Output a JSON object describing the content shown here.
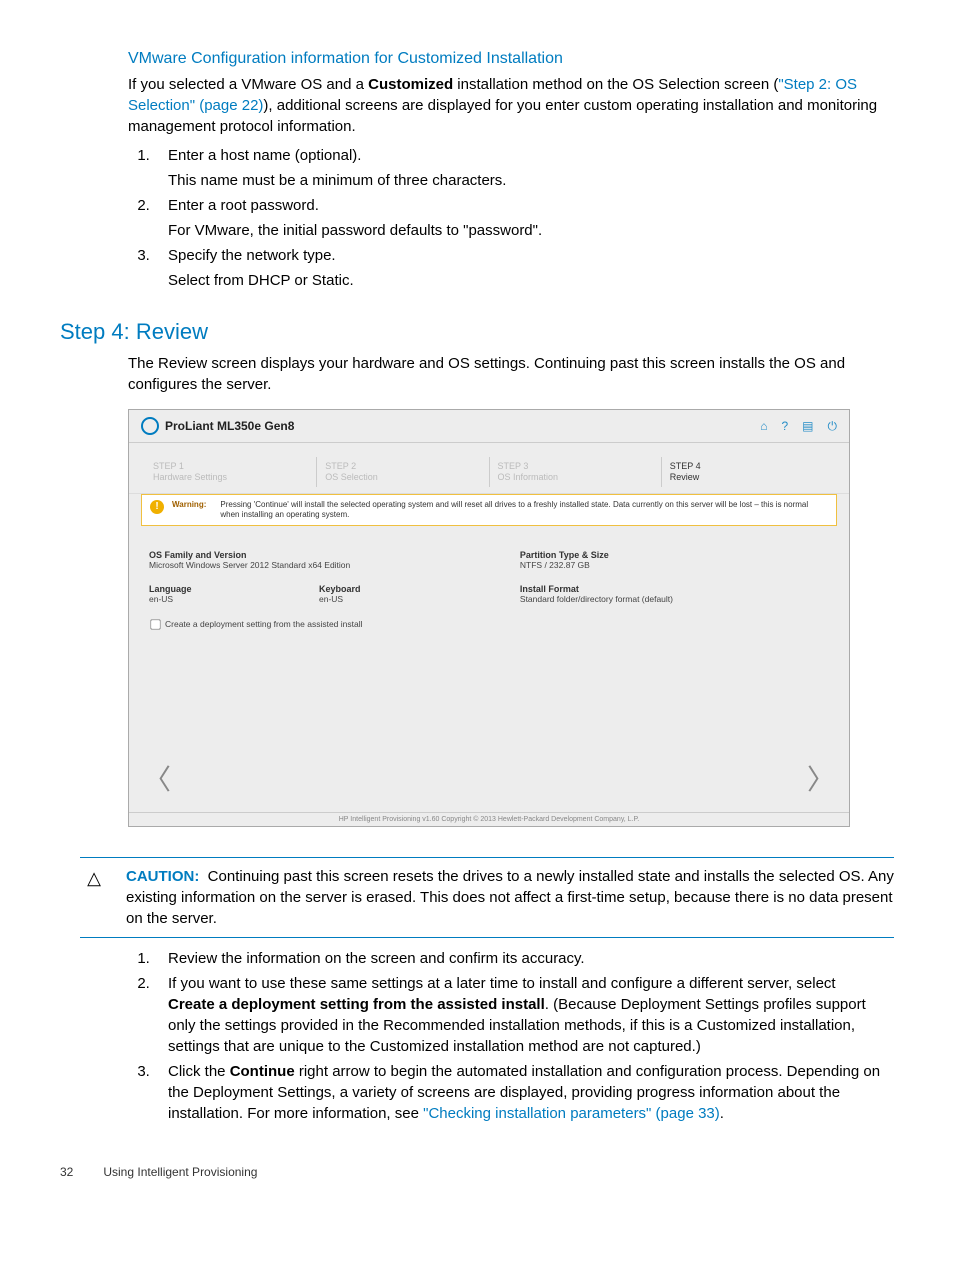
{
  "section_vmware": {
    "heading": "VMware Configuration information for Customized Installation",
    "intro_pre": "If you selected a VMware OS and a ",
    "intro_bold": "Customized",
    "intro_mid": " installation method on the OS Selection screen (",
    "intro_link": "\"Step 2: OS Selection\" (page 22)",
    "intro_post": "), additional screens are displayed for you enter custom operating installation and monitoring management protocol information.",
    "list": [
      {
        "main": "Enter a host name (optional).",
        "sub": "This name must be a minimum of three characters."
      },
      {
        "main": "Enter a root password.",
        "sub": "For VMware, the initial password defaults to \"password\"."
      },
      {
        "main": "Specify the network type.",
        "sub": "Select from DHCP or Static."
      }
    ]
  },
  "step4_heading": "Step 4: Review",
  "step4_intro": "The Review screen displays your hardware and OS settings. Continuing past this screen installs the OS and configures the server.",
  "screenshot": {
    "title": "ProLiant ML350e Gen8",
    "steps": [
      {
        "top": "STEP 1",
        "bottom": "Hardware Settings"
      },
      {
        "top": "STEP 2",
        "bottom": "OS Selection"
      },
      {
        "top": "STEP 3",
        "bottom": "OS Information"
      },
      {
        "top": "STEP 4",
        "bottom": "Review"
      }
    ],
    "warning_label": "Warning:",
    "warning_text": "Pressing 'Continue' will install the selected operating system and will reset all drives to a freshly installed state. Data currently on this server will be lost – this is normal when installing an operating system.",
    "fields": {
      "os_family_label": "OS Family and Version",
      "os_family_val": "Microsoft Windows Server 2012 Standard x64 Edition",
      "partition_label": "Partition Type & Size",
      "partition_val": "NTFS / 232.87 GB",
      "language_label": "Language",
      "language_val": "en-US",
      "keyboard_label": "Keyboard",
      "keyboard_val": "en-US",
      "installfmt_label": "Install Format",
      "installfmt_val": "Standard folder/directory format (default)"
    },
    "checkbox_label": "Create a deployment setting from the assisted install",
    "footer": "HP Intelligent Provisioning v1.60 Copyright © 2013 Hewlett-Packard Development Company, L.P."
  },
  "caution": {
    "label": "CAUTION:",
    "text": "Continuing past this screen resets the drives to a newly installed state and installs the selected OS. Any existing information on the server is erased. This does not affect a first-time setup, because there is no data present on the server."
  },
  "final_list": {
    "item1": "Review the information on the screen and confirm its accuracy.",
    "item2_pre": "If you want to use these same settings at a later time to install and configure a different server, select ",
    "item2_bold": "Create a deployment setting from the assisted install",
    "item2_post": ". (Because Deployment Settings profiles support only the settings provided in the Recommended installation methods, if this is a Customized installation, settings that are unique to the Customized installation method are not captured.)",
    "item3_pre": "Click the ",
    "item3_bold": "Continue",
    "item3_mid": " right arrow to begin the automated installation and configuration process. Depending on the Deployment Settings, a variety of screens are displayed, providing progress information about the installation. For more information, see ",
    "item3_link": "\"Checking installation parameters\" (page 33)",
    "item3_post": "."
  },
  "footer": {
    "page": "32",
    "title": "Using Intelligent Provisioning"
  }
}
